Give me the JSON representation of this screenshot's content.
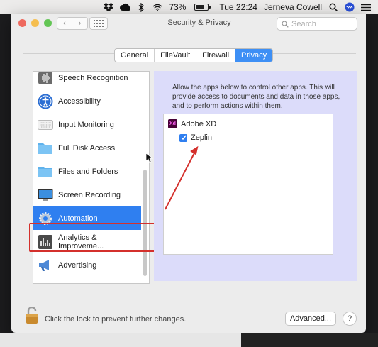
{
  "menubar": {
    "battery_percent": "73%",
    "battery_level": 0.73,
    "clock": "Tue 22:24",
    "user": "Jerneva Cowell"
  },
  "window": {
    "title": "Security & Privacy",
    "search_placeholder": "Search"
  },
  "tabs": [
    {
      "label": "General",
      "active": false
    },
    {
      "label": "FileVault",
      "active": false
    },
    {
      "label": "Firewall",
      "active": false
    },
    {
      "label": "Privacy",
      "active": true
    }
  ],
  "privacy_list": [
    {
      "label": "Speech Recognition",
      "icon": "waveform-icon",
      "selected": false
    },
    {
      "label": "Accessibility",
      "icon": "accessibility-icon",
      "selected": false
    },
    {
      "label": "Input Monitoring",
      "icon": "keyboard-icon",
      "selected": false
    },
    {
      "label": "Full Disk Access",
      "icon": "folder-icon",
      "selected": false
    },
    {
      "label": "Files and Folders",
      "icon": "folder-icon",
      "selected": false
    },
    {
      "label": "Screen Recording",
      "icon": "display-icon",
      "selected": false
    },
    {
      "label": "Automation",
      "icon": "gear-icon",
      "selected": true
    },
    {
      "label": "Analytics & Improveme...",
      "icon": "bar-chart-icon",
      "selected": false
    },
    {
      "label": "Advertising",
      "icon": "megaphone-icon",
      "selected": false
    }
  ],
  "detail": {
    "description": "Allow the apps below to control other apps. This will provide access to documents and data in those apps, and to perform actions within them.",
    "apps": [
      {
        "name": "Adobe XD",
        "icon_text": "Xd",
        "controls": [
          {
            "name": "Zeplin",
            "checked": true
          }
        ]
      }
    ]
  },
  "footer": {
    "lock_text": "Click the lock to prevent further changes.",
    "advanced_label": "Advanced...",
    "help_label": "?"
  },
  "colors": {
    "accent": "#2f7ff0",
    "annotation": "#d4302c",
    "pane": "#dcdcfa"
  }
}
